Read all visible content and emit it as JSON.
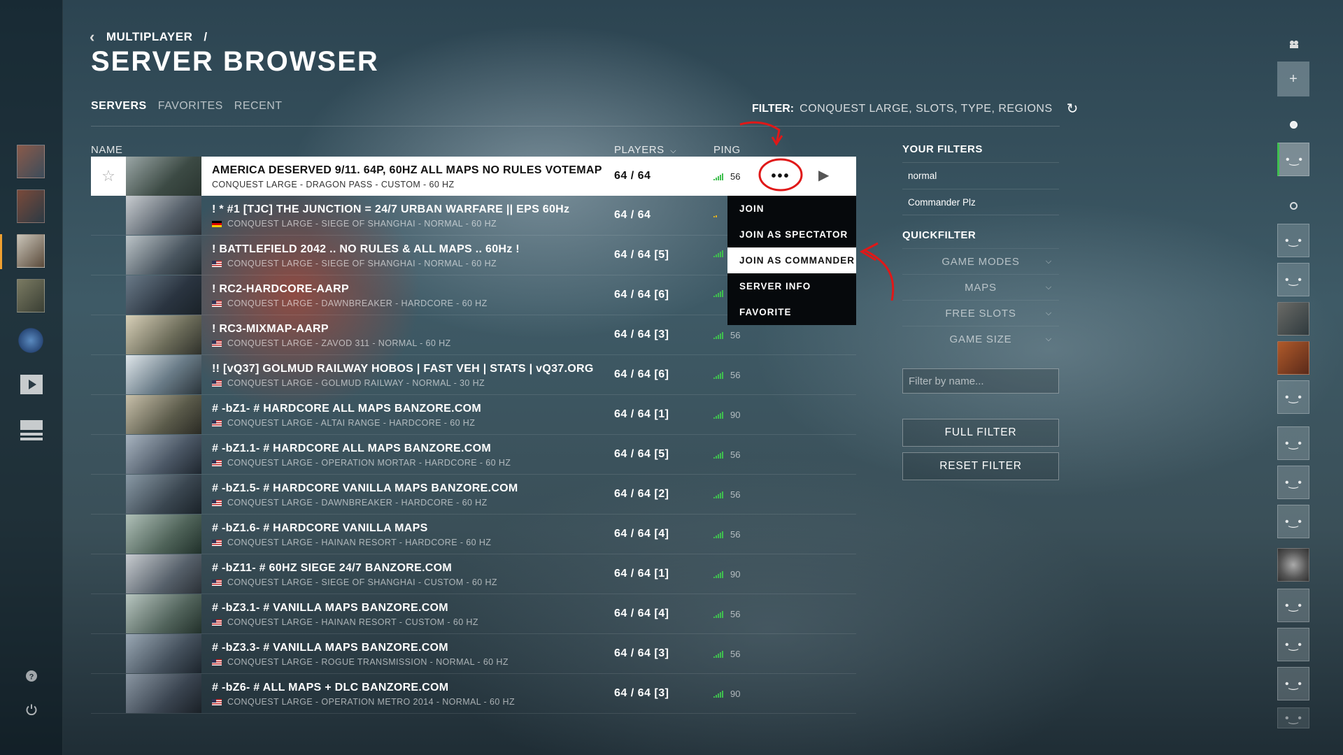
{
  "breadcrumb": {
    "parent": "MULTIPLAYER",
    "separator": "/"
  },
  "page_title": "SERVER BROWSER",
  "tabs": [
    {
      "label": "SERVERS",
      "active": true
    },
    {
      "label": "FAVORITES",
      "active": false
    },
    {
      "label": "RECENT",
      "active": false
    }
  ],
  "filter_summary": {
    "label": "FILTER:",
    "value": "CONQUEST LARGE, SLOTS, TYPE, REGIONS"
  },
  "columns": {
    "name": "NAME",
    "players": "PLAYERS",
    "ping": "PING"
  },
  "servers": [
    {
      "name": "AMERICA DESERVED 9/11. 64P, 60HZ ALL MAPS NO RULES VOTEMAP",
      "sub": "CONQUEST LARGE - DRAGON PASS - CUSTOM - 60 HZ",
      "players": "64 / 64",
      "ping": "56",
      "flag": "",
      "selected": true
    },
    {
      "name": "! * #1 [TJC] THE JUNCTION = 24/7 URBAN WARFARE || EPS 60Hz",
      "sub": "CONQUEST LARGE - SIEGE OF SHANGHAI - NORMAL - 60 HZ",
      "players": "64 / 64",
      "ping": "",
      "flag": "de",
      "signal": "low"
    },
    {
      "name": "! BATTLEFIELD 2042 .. NO RULES & ALL MAPS .. 60Hz !",
      "sub": "CONQUEST LARGE - SIEGE OF SHANGHAI - NORMAL - 60 HZ",
      "players": "64 / 64 [5]",
      "ping": "",
      "flag": "us"
    },
    {
      "name": "! RC2-HARDCORE-AARP",
      "sub": "CONQUEST LARGE - DAWNBREAKER - HARDCORE - 60 HZ",
      "players": "64 / 64 [6]",
      "ping": "",
      "flag": "us"
    },
    {
      "name": "! RC3-MIXMAP-AARP",
      "sub": "CONQUEST LARGE - ZAVOD 311 - NORMAL - 60 HZ",
      "players": "64 / 64 [3]",
      "ping": "56",
      "flag": "us"
    },
    {
      "name": "!! [vQ37] GOLMUD RAILWAY HOBOS | FAST VEH | STATS | vQ37.ORG",
      "sub": "CONQUEST LARGE - GOLMUD RAILWAY - NORMAL - 30 HZ",
      "players": "64 / 64 [6]",
      "ping": "56",
      "flag": "us"
    },
    {
      "name": "# -bZ1- #  HARDCORE ALL MAPS BANZORE.COM",
      "sub": "CONQUEST LARGE - ALTAI RANGE - HARDCORE - 60 HZ",
      "players": "64 / 64 [1]",
      "ping": "90",
      "flag": "us"
    },
    {
      "name": "# -bZ1.1- #  HARDCORE ALL MAPS BANZORE.COM",
      "sub": "CONQUEST LARGE - OPERATION MORTAR - HARDCORE - 60 HZ",
      "players": "64 / 64 [5]",
      "ping": "56",
      "flag": "us"
    },
    {
      "name": "# -bZ1.5- #  HARDCORE VANILLA MAPS BANZORE.COM",
      "sub": "CONQUEST LARGE - DAWNBREAKER - HARDCORE - 60 HZ",
      "players": "64 / 64 [2]",
      "ping": "56",
      "flag": "us"
    },
    {
      "name": "# -bZ1.6- # HARDCORE VANILLA MAPS",
      "sub": "CONQUEST LARGE - HAINAN RESORT - HARDCORE - 60 HZ",
      "players": "64 / 64 [4]",
      "ping": "56",
      "flag": "us"
    },
    {
      "name": "# -bZ11- # 60HZ SIEGE 24/7 BANZORE.COM",
      "sub": "CONQUEST LARGE - SIEGE OF SHANGHAI - CUSTOM - 60 HZ",
      "players": "64 / 64 [1]",
      "ping": "90",
      "flag": "us"
    },
    {
      "name": "# -bZ3.1- # VANILLA MAPS BANZORE.COM",
      "sub": "CONQUEST LARGE - HAINAN RESORT - CUSTOM - 60 HZ",
      "players": "64 / 64 [4]",
      "ping": "56",
      "flag": "us"
    },
    {
      "name": "# -bZ3.3- # VANILLA MAPS BANZORE.COM",
      "sub": "CONQUEST LARGE - ROGUE TRANSMISSION - NORMAL - 60 HZ",
      "players": "64 / 64 [3]",
      "ping": "56",
      "flag": "us"
    },
    {
      "name": "# -bZ6- # ALL MAPS + DLC BANZORE.COM",
      "sub": "CONQUEST LARGE - OPERATION METRO 2014 - NORMAL - 60 HZ",
      "players": "64 / 64 [3]",
      "ping": "90",
      "flag": "us"
    }
  ],
  "context_menu": [
    {
      "label": "JOIN",
      "highlight": false
    },
    {
      "label": "JOIN AS SPECTATOR",
      "highlight": false
    },
    {
      "label": "JOIN AS COMMANDER",
      "highlight": true
    },
    {
      "label": "SERVER INFO",
      "highlight": false
    },
    {
      "label": "FAVORITE",
      "highlight": false
    }
  ],
  "your_filters": {
    "title": "YOUR FILTERS",
    "items": [
      "normal",
      "Commander Plz"
    ]
  },
  "quickfilter": {
    "title": "QUICKFILTER",
    "items": [
      "GAME MODES",
      "MAPS",
      "FREE SLOTS",
      "GAME SIZE"
    ]
  },
  "filter_input": {
    "placeholder": "Filter by name..."
  },
  "buttons": {
    "full_filter": "FULL FILTER",
    "reset_filter": "RESET FILTER"
  },
  "icons": {
    "back": "chevron-left-icon",
    "refresh": "refresh-icon",
    "star": "star-icon",
    "more": "more-icon",
    "play": "play-icon",
    "help": "help-icon",
    "power": "power-icon"
  },
  "colors": {
    "accent_orange": "#f0a030",
    "ping_green": "#3fbf4f",
    "annotation_red": "#e01818"
  }
}
